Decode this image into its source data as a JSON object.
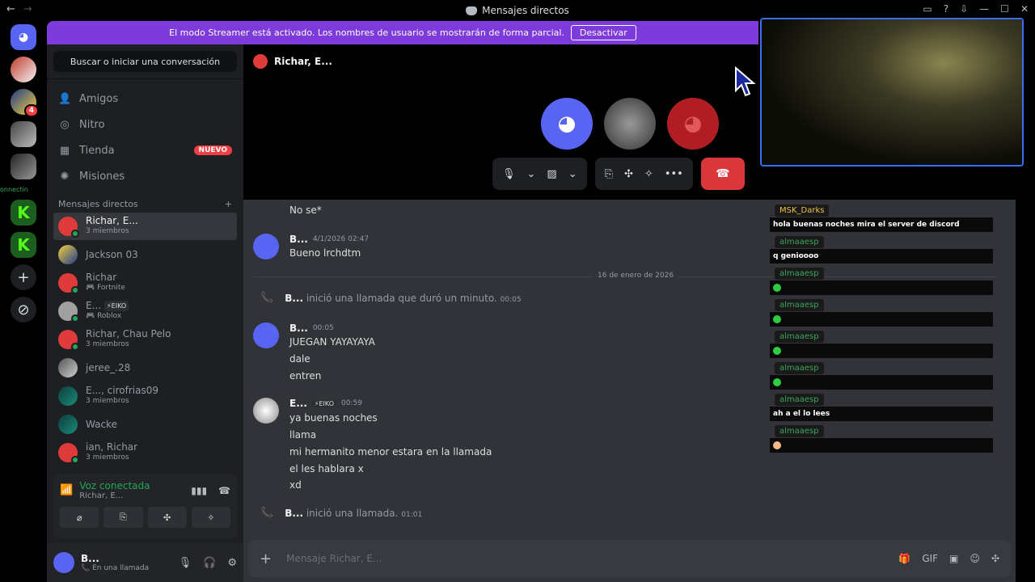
{
  "titlebar": {
    "back": "←",
    "forward": "→",
    "title": "Mensajes directos",
    "controls": [
      "▭",
      "?",
      "⇩",
      "—",
      "☐",
      "✕"
    ]
  },
  "banner": {
    "text": "El modo Streamer está activado. Los nombres de usuario se mostrarán de forma parcial.",
    "button": "Desactivar"
  },
  "guilds": {
    "connect_label": "onnectin",
    "badge_count": "4",
    "kick_letter": "K",
    "add_symbol": "+",
    "discover_symbol": "⊘"
  },
  "sidebar": {
    "search": "Buscar o iniciar una conversación",
    "nav": [
      {
        "label": "Amigos",
        "icon": "👤"
      },
      {
        "label": "Nitro",
        "icon": "◎"
      },
      {
        "label": "Tienda",
        "icon": "▦",
        "badge": "NUEVO"
      },
      {
        "label": "Misiones",
        "icon": "✺"
      }
    ],
    "dm_header": "Mensajes directos",
    "dm_add": "+",
    "dms": [
      {
        "name": "Richar, E...",
        "sub": "3 miembros"
      },
      {
        "name": "Jackson 03",
        "sub": ""
      },
      {
        "name": "Richar",
        "sub": "🎮 Fortnite"
      },
      {
        "name": "E...",
        "tag": "⚡EIKO",
        "sub": "🎮 Roblox"
      },
      {
        "name": "Richar, Chau Pelo",
        "sub": "3 miembros"
      },
      {
        "name": "jeree_.28",
        "sub": ""
      },
      {
        "name": "E..., cirofrias09",
        "sub": "3 miembros"
      },
      {
        "name": "Wacke",
        "sub": ""
      },
      {
        "name": "ian, Richar",
        "sub": "3 miembros"
      }
    ],
    "voice": {
      "title": "Voz conectada",
      "channel": "Richar, E...",
      "buttons": [
        "⌀",
        "⎘",
        "✣",
        "✧"
      ]
    },
    "user": {
      "name": "B...",
      "status": "📞 En una llamada"
    }
  },
  "call": {
    "header": "Richar, E...",
    "controls": {
      "mic": "🎙",
      "camera": "▨",
      "screen": "⎘",
      "activities": "✣",
      "soundboard": "✧",
      "more": "•••",
      "end": "☎"
    }
  },
  "messages": {
    "top_line": "No se*",
    "m1": {
      "author": "B...",
      "time": "4/1/2026 02:47",
      "lines": [
        "Bueno lrchdtm"
      ]
    },
    "date_divider": "16 de enero de 2026",
    "sys1": {
      "author": "B...",
      "text": "inició una llamada que duró un minuto.",
      "time": "00:05"
    },
    "m2": {
      "author": "B...",
      "time": "00:05",
      "lines": [
        "JUEGAN YAYAYAYA",
        "dale",
        "entren"
      ]
    },
    "m3": {
      "author": "E...",
      "tag": "⚡EIKO",
      "time": "00:59",
      "lines": [
        "ya buenas noches",
        "llama",
        "mi hermanito menor estara en la llamada",
        "el les hablara x",
        "xd"
      ]
    },
    "sys2": {
      "author": "B...",
      "text": "inició una llamada.",
      "time": "01:01"
    }
  },
  "composer": {
    "placeholder": "Mensaje Richar, E...",
    "tools": [
      "🎁",
      "GIF",
      "▣",
      "☺",
      "✣"
    ]
  },
  "overlay_chat": [
    {
      "user": "MSK_Darks",
      "text": "hola buenas noches mira el server de discord"
    },
    {
      "user": "almaaesp",
      "text": "q genioooo"
    },
    {
      "user": "almaaesp",
      "text": ""
    },
    {
      "user": "almaaesp",
      "text": ""
    },
    {
      "user": "almaaesp",
      "text": ""
    },
    {
      "user": "almaaesp",
      "text": ""
    },
    {
      "user": "almaaesp",
      "text": "ah a el lo lees"
    },
    {
      "user": "almaaesp",
      "text": ""
    }
  ]
}
